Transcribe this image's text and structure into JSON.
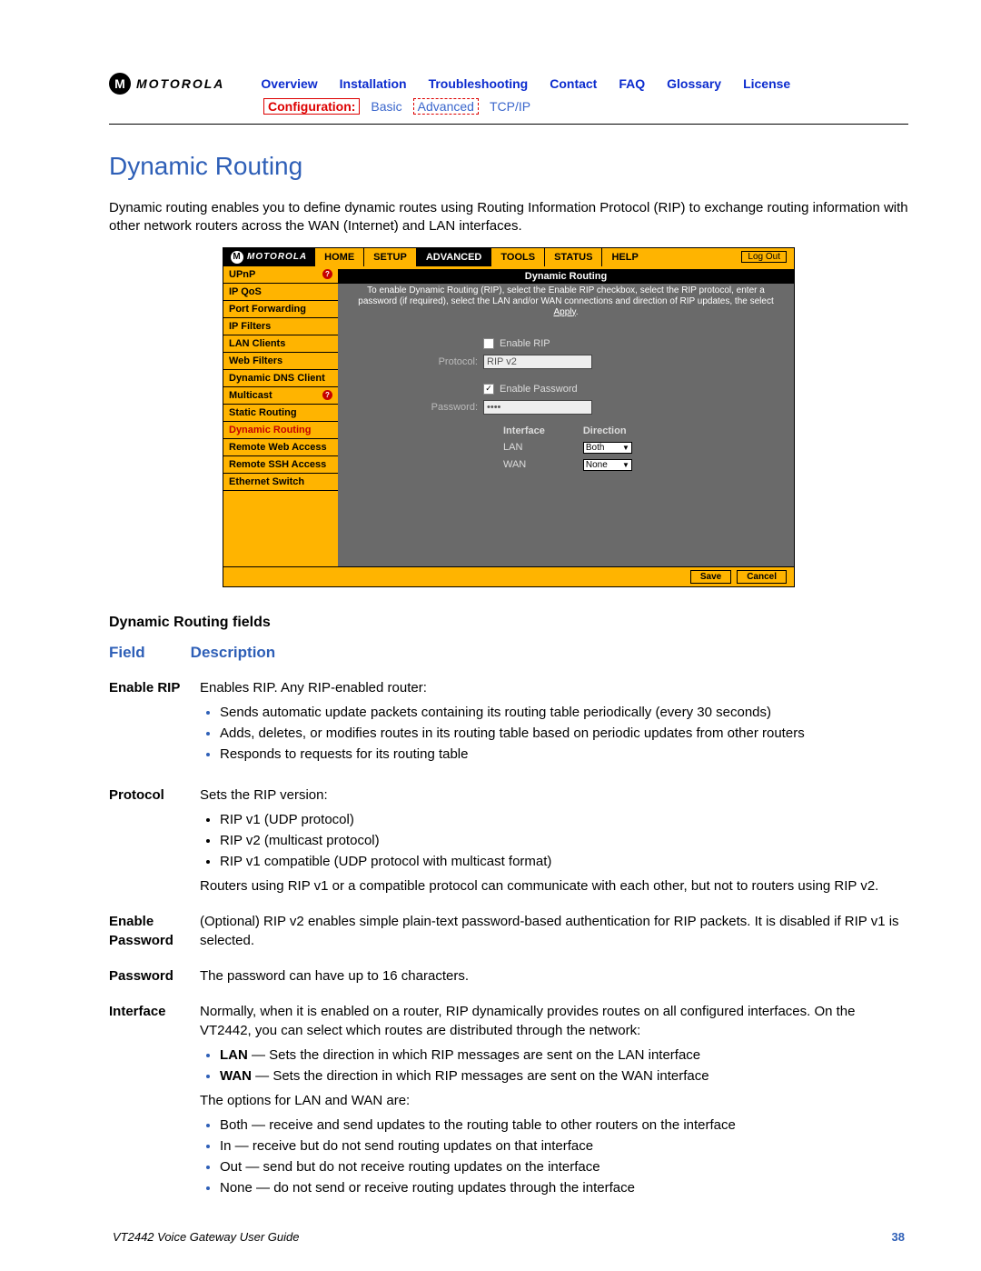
{
  "brand": "MOTOROLA",
  "top_nav": {
    "overview": "Overview",
    "installation": "Installation",
    "troubleshooting": "Troubleshooting",
    "contact": "Contact",
    "faq": "FAQ",
    "glossary": "Glossary",
    "license": "License"
  },
  "sub_nav": {
    "config_label": "Configuration:",
    "basic": "Basic",
    "advanced": "Advanced",
    "tcpip": "TCP/IP"
  },
  "section_title": "Dynamic Routing",
  "intro": "Dynamic routing enables you to define dynamic routes using Routing Information Protocol (RIP) to exchange routing information with other network routers across the WAN (Internet) and LAN interfaces.",
  "shot": {
    "tabs": {
      "home": "HOME",
      "setup": "SETUP",
      "advanced": "ADVANCED",
      "tools": "TOOLS",
      "status": "STATUS",
      "help": "HELP"
    },
    "logout": "Log Out",
    "sidebar": [
      {
        "label": "UPnP",
        "help": true
      },
      {
        "label": "IP QoS"
      },
      {
        "label": "Port Forwarding"
      },
      {
        "label": "IP Filters"
      },
      {
        "label": "LAN Clients"
      },
      {
        "label": "Web Filters"
      },
      {
        "label": "Dynamic DNS Client"
      },
      {
        "label": "Multicast",
        "help": true
      },
      {
        "label": "Static Routing"
      },
      {
        "label": "Dynamic Routing",
        "selected": true
      },
      {
        "label": "Remote Web Access"
      },
      {
        "label": "Remote SSH Access"
      },
      {
        "label": "Ethernet Switch"
      }
    ],
    "panel_title": "Dynamic Routing",
    "panel_desc": "To enable Dynamic Routing (RIP), select the Enable RIP checkbox, select the RIP protocol, enter a password (if required), select the LAN and/or WAN connections and direction of RIP updates, the select ",
    "apply_word": "Apply",
    "form": {
      "enable_rip_label": "Enable RIP",
      "protocol_label": "Protocol:",
      "protocol_value": "RIP v2",
      "enable_pw_label": "Enable Password",
      "password_label": "Password:",
      "password_value": "••••",
      "iface_hdr": "Interface",
      "dir_hdr": "Direction",
      "rows": [
        {
          "iface": "LAN",
          "dir": "Both"
        },
        {
          "iface": "WAN",
          "dir": "None"
        }
      ]
    },
    "save": "Save",
    "cancel": "Cancel"
  },
  "fields_title": "Dynamic Routing fields",
  "fields_headers": {
    "field": "Field",
    "desc": "Description"
  },
  "fields": {
    "enable_rip": {
      "name": "Enable RIP",
      "lead": "Enables RIP. Any RIP-enabled router:",
      "bullets": [
        "Sends automatic update packets containing its routing table periodically (every 30 seconds)",
        "Adds, deletes, or modifies routes in its routing table based on periodic updates from other routers",
        "Responds to requests for its routing table"
      ]
    },
    "protocol": {
      "name": "Protocol",
      "lead": "Sets the RIP version:",
      "bullets": [
        "RIP v1 (UDP protocol)",
        "RIP v2 (multicast protocol)",
        "RIP v1 compatible (UDP protocol with multicast format)"
      ],
      "tail": "Routers using RIP v1 or a compatible protocol can communicate with each other, but not to routers using RIP v2."
    },
    "enable_pw": {
      "name": "Enable Password",
      "desc": "(Optional) RIP v2 enables simple plain-text password-based authentication for RIP packets. It is disabled if RIP v1 is selected."
    },
    "password": {
      "name": "Password",
      "desc": "The password can have up to 16 characters."
    },
    "interface": {
      "name": "Interface",
      "lead": "Normally, when it is enabled on a router, RIP dynamically provides routes on all configured interfaces. On the VT2442, you can select which routes are distributed through the network:",
      "top_bullets": [
        {
          "strong": "LAN",
          "text": " — Sets the direction in which RIP messages are sent on the LAN interface"
        },
        {
          "strong": "WAN",
          "text": " — Sets the direction in which RIP messages are sent on the WAN interface"
        }
      ],
      "mid": "The options for LAN and WAN are:",
      "opts": [
        "Both — receive and send updates to the routing table to other routers on the interface",
        "In — receive but do not send routing updates on that interface",
        "Out — send but do not receive routing updates on the interface",
        "None — do not send or receive routing updates through the interface"
      ]
    }
  },
  "footer": {
    "guide": "VT2442 Voice Gateway User Guide",
    "page": "38"
  }
}
